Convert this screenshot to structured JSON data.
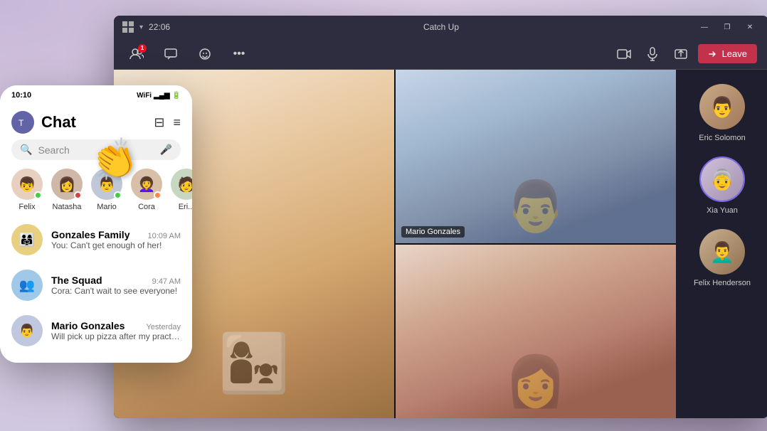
{
  "app": {
    "title": "Catch Up",
    "time": "22:06"
  },
  "window_controls": {
    "minimize": "—",
    "restore": "❐",
    "close": "✕"
  },
  "toolbar": {
    "participants_count": "1",
    "more_label": "•••",
    "leave_label": "Leave"
  },
  "participants": [
    {
      "name": "Eric Solomon",
      "avatar_emoji": "👨",
      "active": false
    },
    {
      "name": "Xia Yuan",
      "avatar_emoji": "👵",
      "active": true
    },
    {
      "name": "Felix Henderson",
      "avatar_emoji": "👨‍🦱",
      "active": false
    }
  ],
  "video_labels": {
    "mario": "Mario Gonzales"
  },
  "mobile": {
    "status_bar": {
      "time": "10:10",
      "signal": "▂▄▆",
      "wifi": "WiFi",
      "battery": "●"
    },
    "header": {
      "title": "Chat",
      "edit_icon": "✏",
      "filter_icon": "≡"
    },
    "search": {
      "placeholder": "Search",
      "mic_icon": "🎤"
    },
    "contacts": [
      {
        "name": "Felix",
        "status_color": "#44cc44",
        "emoji": "👦"
      },
      {
        "name": "Natasha",
        "status_color": "#cc4444",
        "emoji": "👩"
      },
      {
        "name": "Mario",
        "status_color": "#44cc44",
        "emoji": "👨"
      },
      {
        "name": "Cora",
        "status_color": "#ff8844",
        "emoji": "👩‍🦱"
      },
      {
        "name": "Eri...",
        "status_color": "#44cc44",
        "emoji": "🧑"
      }
    ],
    "chats": [
      {
        "name": "Gonzales Family",
        "time": "10:09 AM",
        "preview": "You: Can't get enough of her!",
        "emoji": "👨‍👩‍👧"
      },
      {
        "name": "The Squad",
        "time": "9:47 AM",
        "preview": "Cora: Can't wait to see everyone!",
        "emoji": "👥"
      },
      {
        "name": "Mario Gonzales",
        "time": "Yesterday",
        "preview": "Will pick up pizza after my practice.",
        "emoji": "👨"
      }
    ]
  },
  "emoji_overlay": "👏"
}
